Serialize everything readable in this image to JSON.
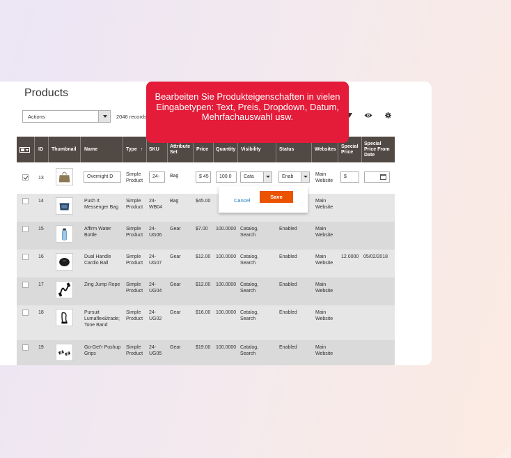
{
  "page_title": "Products",
  "actions": {
    "label": "Actions"
  },
  "records": "2046 records",
  "tooltip": "Bearbeiten Sie Produkteigenschaften in vielen Eingabetypen: Text, Preis, Dropdown, Datum, Mehrfachauswahl usw.",
  "columns": {
    "id": "ID",
    "thumbnail": "Thumbnail",
    "name": "Name",
    "type": "Type",
    "sort_arrow": "↑",
    "sku": "SKU",
    "attribute_set": "Attribute Set",
    "price": "Price",
    "quantity": "Quantity",
    "visibility": "Visibility",
    "status": "Status",
    "websites": "Websites",
    "special_price": "Special Price",
    "special_price_from": "Special Price From Date"
  },
  "edit_row": {
    "id": "13",
    "name": "Overnight D",
    "type": "Simple Product",
    "sku": "24-",
    "attribute_set": "Bag",
    "price": "$ 45",
    "quantity": "100.0",
    "visibility": "Cata",
    "status": "Enab",
    "websites": "Main Website",
    "special_price": "$"
  },
  "edit_actions": {
    "cancel": "Cancel",
    "save": "Save"
  },
  "rows": [
    {
      "id": "14",
      "name": "Push It Messenger Bag",
      "type": "Simple Product",
      "sku": "24-WB04",
      "attribute_set": "Bag",
      "price": "$45.00",
      "quantity": "",
      "visibility": "",
      "status": "",
      "websites": "Main Website",
      "special_price": "",
      "special_from": "",
      "thumb": "bag-icon"
    },
    {
      "id": "15",
      "name": "Affirm Water Bottle",
      "type": "Simple Product",
      "sku": "24-UG06",
      "attribute_set": "Gear",
      "price": "$7.00",
      "quantity": "100.0000",
      "visibility": "Catalog, Search",
      "status": "Enabled",
      "websites": "Main Website",
      "special_price": "",
      "special_from": "",
      "thumb": "bottle-icon"
    },
    {
      "id": "16",
      "name": "Dual Handle Cardio Ball",
      "type": "Simple Product",
      "sku": "24-UG07",
      "attribute_set": "Gear",
      "price": "$12.00",
      "quantity": "100.0000",
      "visibility": "Catalog, Search",
      "status": "Enabled",
      "websites": "Main Website",
      "special_price": "12.0000",
      "special_from": "05/02/2018",
      "thumb": "ball-icon"
    },
    {
      "id": "17",
      "name": "Zing Jump Rope",
      "type": "Simple Product",
      "sku": "24-UG04",
      "attribute_set": "Gear",
      "price": "$12.00",
      "quantity": "100.0000",
      "visibility": "Catalog, Search",
      "status": "Enabled",
      "websites": "Main Website",
      "special_price": "",
      "special_from": "",
      "thumb": "rope-icon"
    },
    {
      "id": "18",
      "name": "Pursuit Lumaflex&trade; Tone Band",
      "type": "Simple Product",
      "sku": "24-UG02",
      "attribute_set": "Gear",
      "price": "$16.00",
      "quantity": "100.0000",
      "visibility": "Catalog, Search",
      "status": "Enabled",
      "websites": "Main Website",
      "special_price": "",
      "special_from": "",
      "thumb": "band-icon"
    },
    {
      "id": "19",
      "name": "Go-Get'r Pushup Grips",
      "type": "Simple Product",
      "sku": "24-UG05",
      "attribute_set": "Gear",
      "price": "$19.00",
      "quantity": "100.0000",
      "visibility": "Catalog, Search",
      "status": "Enabled",
      "websites": "Main Website",
      "special_price": "",
      "special_from": "",
      "thumb": "grips-icon"
    }
  ]
}
